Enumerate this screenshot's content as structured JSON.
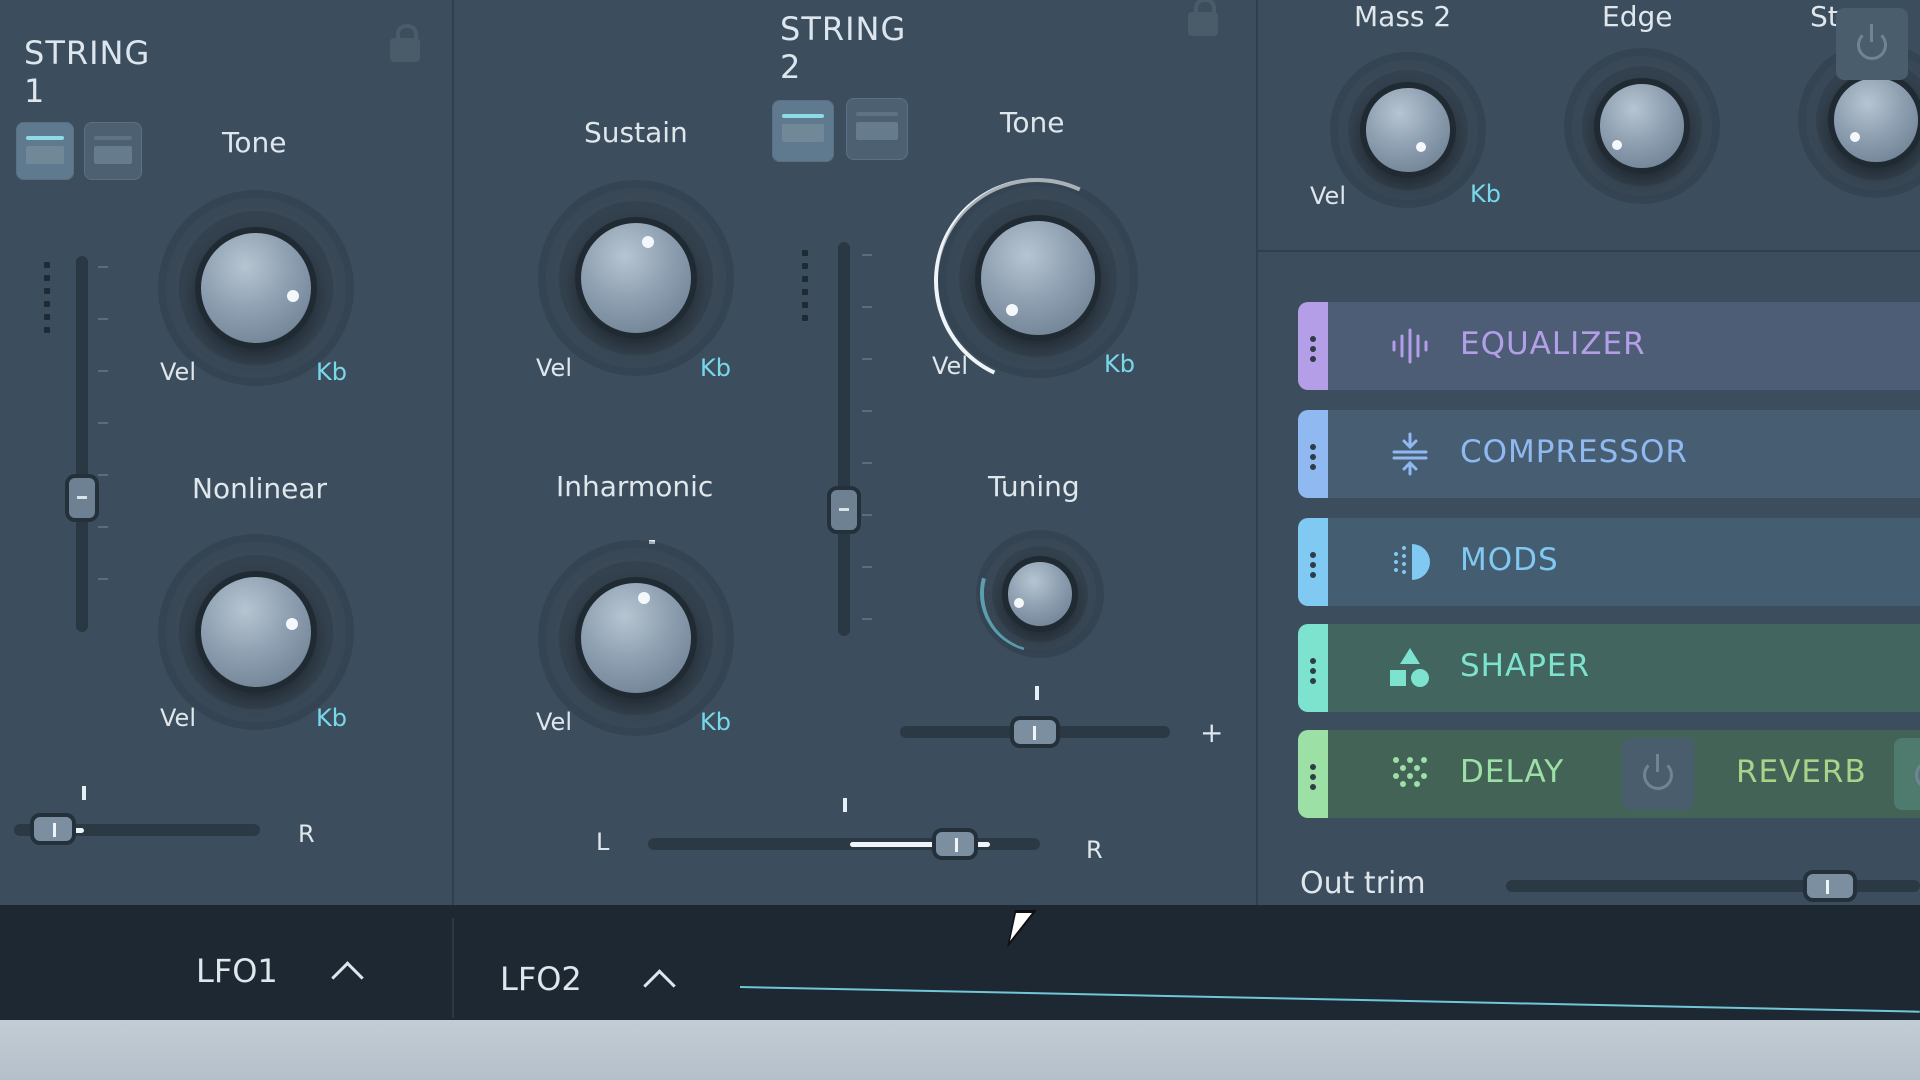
{
  "string1": {
    "title": "STRING 1",
    "tone_label": "Tone",
    "tone_vel": "Vel",
    "tone_kb": "Kb",
    "nonlinear_label": "Nonlinear",
    "nonlinear_vel": "Vel",
    "nonlinear_kb": "Kb",
    "pan_right": "R",
    "pan_value": 0.08
  },
  "string2": {
    "title": "STRING 2",
    "sustain_label": "Sustain",
    "sustain_vel": "Vel",
    "sustain_kb": "Kb",
    "inharmonic_label": "Inharmonic",
    "inharmonic_vel": "Vel",
    "inharmonic_kb": "Kb",
    "tone_label": "Tone",
    "tone_vel": "Vel",
    "tone_kb": "Kb",
    "tuning_label": "Tuning",
    "tuning_plus": "+",
    "pan_left": "L",
    "pan_right": "R",
    "pan_value": 0.82
  },
  "mass": {
    "mass2_label": "Mass 2",
    "mass2_vel": "Vel",
    "mass2_kb": "Kb",
    "edge_label": "Edge",
    "strength_label": "Streng"
  },
  "effects": [
    {
      "label": "EQUALIZER",
      "color": "#b59ee8",
      "icon": "equalizer-icon"
    },
    {
      "label": "COMPRESSOR",
      "color": "#8fb9f0",
      "icon": "compressor-icon"
    },
    {
      "label": "MODS",
      "color": "#7fc9f2",
      "icon": "mods-icon"
    },
    {
      "label": "SHAPER",
      "color": "#7de3cf",
      "icon": "shaper-icon"
    },
    {
      "label": "DELAY",
      "color": "#9de0a5",
      "icon": "delay-icon"
    },
    {
      "label": "REVERB",
      "color": "#a8d48a",
      "icon": "reverb-power-icon"
    }
  ],
  "out_trim": {
    "label": "Out trim",
    "value": 0.9
  },
  "bottom": {
    "lfo1": "LFO1",
    "lfo2": "LFO2"
  },
  "colors": {
    "panel": "#3c4e5d",
    "accent": "#78d8ea",
    "bottom_bar": "#1d2833"
  }
}
